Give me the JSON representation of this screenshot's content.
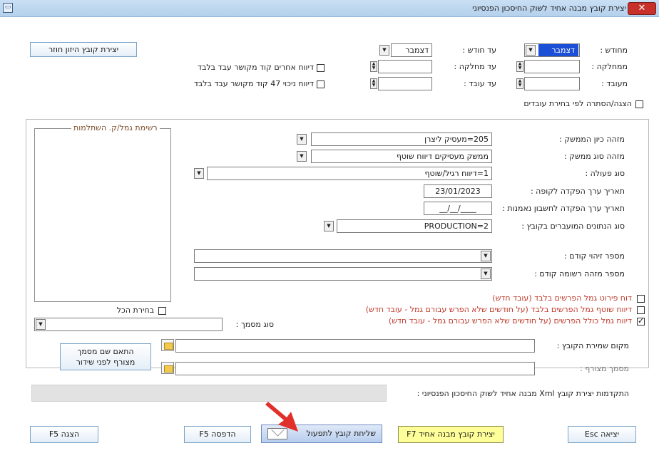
{
  "window": {
    "title": "יצירת קובץ מבנה אחיד לשוק החיסכון הפנסיוני",
    "close_icon": "close-icon",
    "app_icon": "app-icon"
  },
  "top": {
    "from_month_label": "מחודש :",
    "from_month_value": "דצמבר",
    "to_month_label": "עד חודש :",
    "to_month_value": "דצמבר",
    "from_dept_label": "ממחלקה :",
    "to_dept_label": "עד מחלקה :",
    "from_emp_label": "מעובד :",
    "to_emp_label": "עד עובד :",
    "report_others_label": "דיווח אחרים קוד מקושר עבד בלבד",
    "report_47_label": "דיווח ניכוי 47 קוד מקושר עבד בלבד",
    "show_hide_label": "הצגה/הסתרה לפי בחירת עובדים",
    "create_file_button": "יצירת קובץ היזון חוזר"
  },
  "fields": {
    "employer_id_label": "מזהה כיון הממשק :",
    "employer_id_value": "205=מעסיק ליצרן",
    "interface_id_label": "מזהה סוג ממשק :",
    "interface_id_value": "ממשק מעסיקים דיווח שוטף",
    "action_type_label": "סוג פעולה :",
    "action_type_value": "1=דיווח רגיל/שוטף",
    "value_date_label": "תאריך ערך הפקדה לקופה :",
    "value_date_value": "23/01/2023",
    "value_date_account_label": "תאריך ערך הפקדה לחשבון נאמנות :",
    "value_date_account_value": "__/__/____",
    "data_type_label": "סוג הנתונים המועברים בקובץ :",
    "data_type_value": "PRODUCTION=2",
    "prev_id_label": "מספר זיהוי קודם :",
    "prev_record_label": "מספר מזהה רשומה קודם :"
  },
  "listbox": {
    "title": "רשימת גמל/ק. השתלמות",
    "select_all_label": "בחירת הכל"
  },
  "reports": {
    "r1": "דוח פירוט גמל הפרשים בלבד (עובד חדש)",
    "r2": "דיווח שוטף גמל הפרשים בלבד (על חודשים שלא הפרש עבורם גמל - עובד חדש)",
    "r3": "דיווח גמל כולל הפרשים (על חודשים שלא הפרש עבורם גמל - עובד חדש)"
  },
  "doc_type_label": "סוג מסמך :",
  "file_location_label": "מקום שמירת הקובץ :",
  "attached_doc_label": "מסמך מצורף :",
  "match_doc_button": [
    "התאם שם מסמך",
    "מצורף לפני שידור"
  ],
  "progress_label": "התקדמות יצירת קובץ Xml מבנה אחיד לשוק החיסכון הפנסיוני :",
  "bottom": {
    "exit_button": "יציאה Esc",
    "create_uniform_button": "יצירת קובץ מבנה אחיד F7",
    "send_file_button": "שליחת קובץ לתפעול",
    "print_button": "הדפסה F5",
    "show_button": "הצגה F5"
  },
  "colors": {
    "title_bar": "#c9dff3",
    "selection": "#1a4fd6",
    "report_text": "#c0392b",
    "yellow_button": "#ffff99",
    "arrow": "#e0302a"
  }
}
